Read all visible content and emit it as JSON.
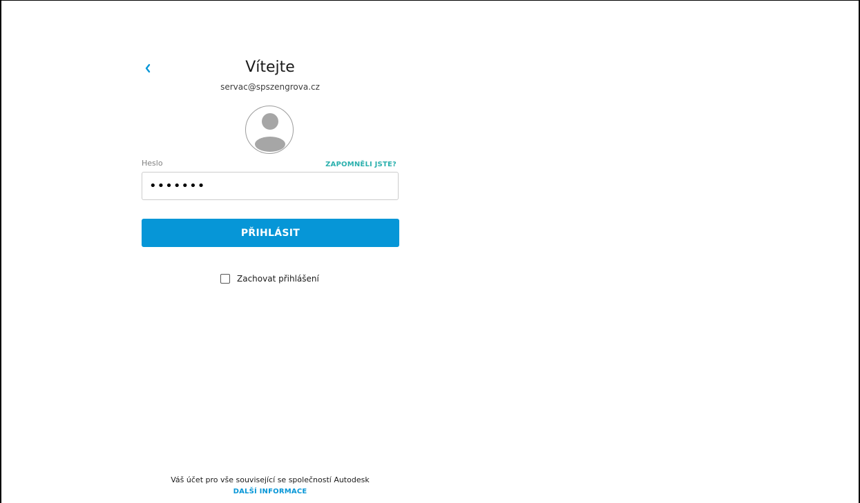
{
  "header": {
    "title": "Vítejte",
    "email": "servac@spszengrova.cz"
  },
  "password": {
    "label": "Heslo",
    "value": "•••••••",
    "forgot_label": "ZAPOMNĚLI JSTE?"
  },
  "login_button": {
    "label": "PŘIHLÁSIT"
  },
  "remember": {
    "label": "Zachovat přihlášení",
    "checked": false
  },
  "footer": {
    "text": "Váš účet pro vše související se společností Autodesk",
    "link": "DALŠÍ INFORMACE"
  },
  "icons": {
    "back": "chevron-left-icon",
    "avatar": "user-avatar-icon"
  },
  "colors": {
    "accent": "#0696d7",
    "link_teal": "#2bb0ad",
    "avatar_gray": "#a6a6a6"
  }
}
